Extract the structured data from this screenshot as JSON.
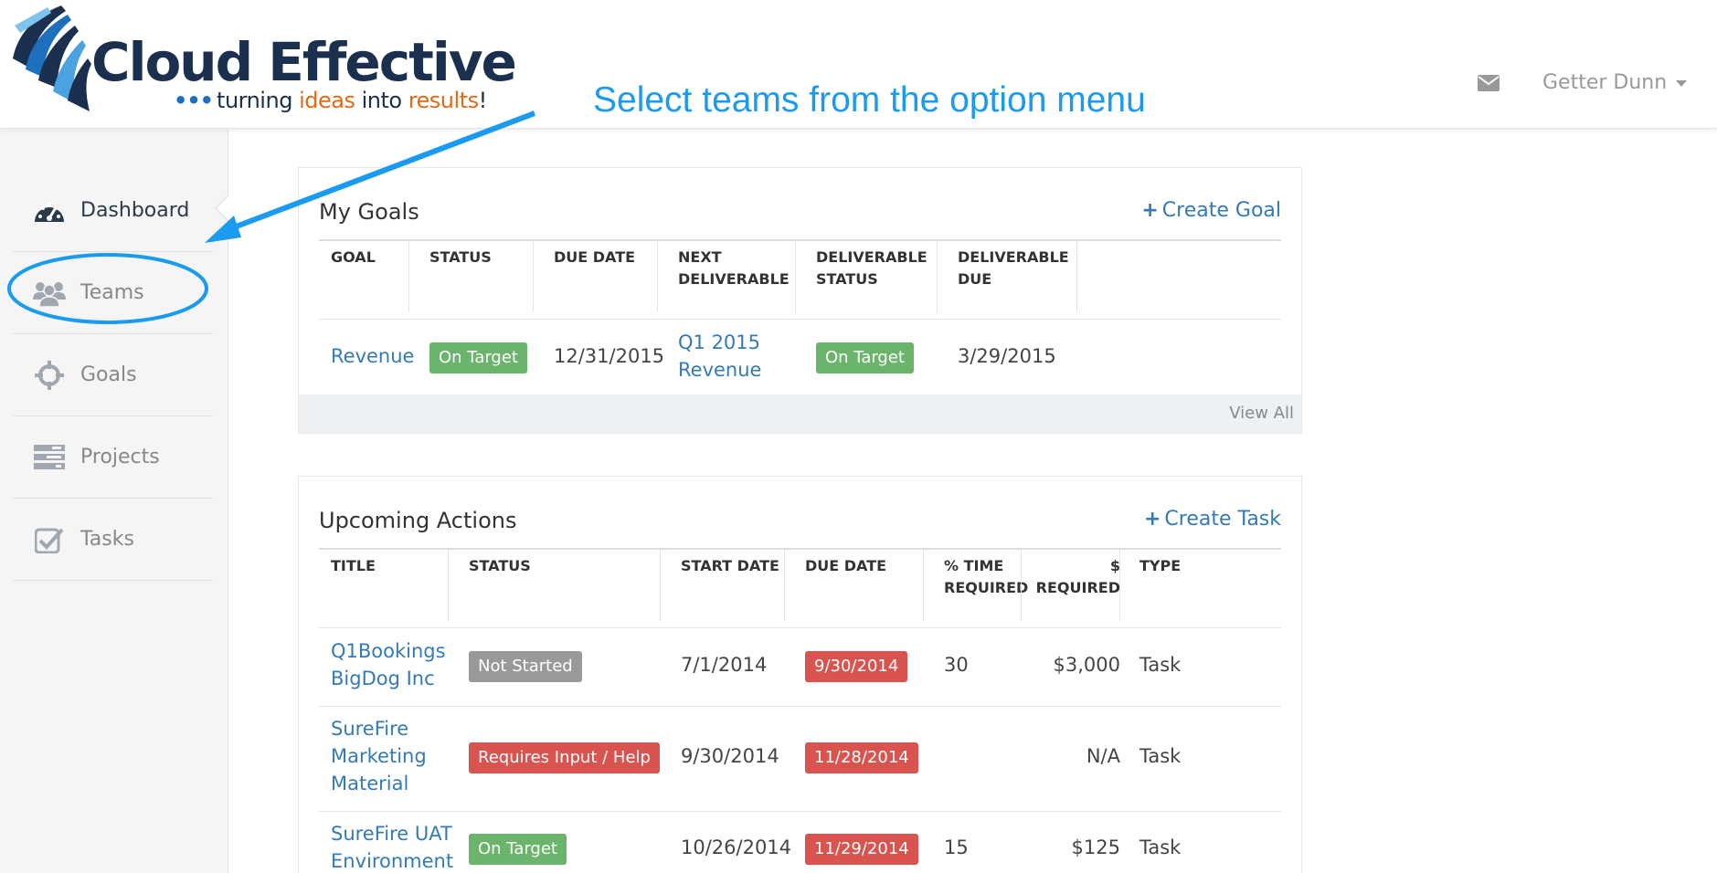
{
  "header": {
    "logo_title": "Cloud Effective",
    "logo_tagline_dots": "•••",
    "logo_tagline_a": "turning ",
    "logo_tagline_b": "ideas",
    "logo_tagline_c": " into ",
    "logo_tagline_d": "results",
    "logo_tagline_e": "!",
    "user_name": "Getter Dunn",
    "mail_icon": "envelope-icon"
  },
  "annotation": {
    "text": "Select teams from the option menu",
    "color": "#1a9bf0"
  },
  "sidebar": {
    "items": [
      {
        "label": "Dashboard",
        "icon": "dashboard-gauge-icon",
        "active": true
      },
      {
        "label": "Teams",
        "icon": "users-icon",
        "active": false
      },
      {
        "label": "Goals",
        "icon": "crosshairs-icon",
        "active": false
      },
      {
        "label": "Projects",
        "icon": "tasks-bars-icon",
        "active": false
      },
      {
        "label": "Tasks",
        "icon": "check-square-icon",
        "active": false
      }
    ]
  },
  "goals": {
    "title": "My Goals",
    "create_label": "Create Goal",
    "columns": [
      "GOAL",
      "STATUS",
      "DUE DATE",
      "NEXT",
      "DELIVERABLE",
      "DELIVERABLE",
      "STATUS",
      "DELIVERABLE",
      "DUE"
    ],
    "col_goal": "GOAL",
    "col_status": "STATUS",
    "col_due": "DUE DATE",
    "col_next_1": "NEXT",
    "col_next_2": "DELIVERABLE",
    "col_dstatus_1": "DELIVERABLE",
    "col_dstatus_2": "STATUS",
    "col_ddue_1": "DELIVERABLE",
    "col_ddue_2": "DUE",
    "rows": [
      {
        "goal": "Revenue",
        "status": "On Target",
        "due": "12/31/2015",
        "next_1": "Q1 2015",
        "next_2": "Revenue",
        "deliverable_status": "On Target",
        "deliverable_due": "3/29/2015"
      }
    ],
    "view_all": "View All"
  },
  "actions": {
    "title": "Upcoming Actions",
    "create_label": "Create Task",
    "col_title": "TITLE",
    "col_status": "STATUS",
    "col_start": "START DATE",
    "col_due": "DUE DATE",
    "col_time_1": "% TIME",
    "col_time_2": "REQUIRED",
    "col_cost_1": "$",
    "col_cost_2": "REQUIRED",
    "col_type": "TYPE",
    "rows": [
      {
        "title_1": "Q1Bookings",
        "title_2": "BigDog Inc",
        "title_3": "",
        "status": "Not Started",
        "status_color": "#999999",
        "start": "7/1/2014",
        "due": "9/30/2014",
        "time": "30",
        "cost": "$3,000",
        "type": "Task"
      },
      {
        "title_1": "SureFire",
        "title_2": "Marketing",
        "title_3": "Material",
        "status": "Requires Input / Help",
        "status_color": "#d9534f",
        "start": "9/30/2014",
        "due": "11/28/2014",
        "time": "",
        "cost": "N/A",
        "type": "Task"
      },
      {
        "title_1": "SureFire UAT",
        "title_2": "Environment",
        "title_3": "",
        "status": "On Target",
        "status_color": "#6bb46b",
        "start": "10/26/2014",
        "due": "11/29/2014",
        "time": "15",
        "cost": "$125",
        "type": "Task"
      }
    ]
  }
}
